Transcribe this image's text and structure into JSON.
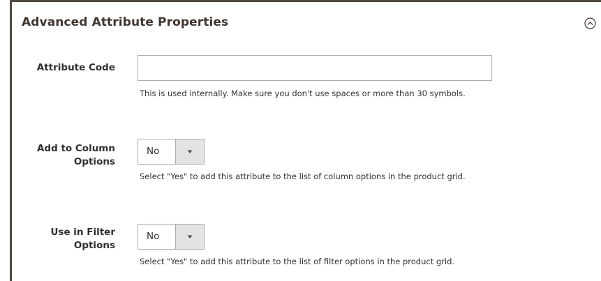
{
  "section": {
    "title": "Advanced Attribute Properties",
    "toggle_icon": "chevron-up-circle-icon"
  },
  "fields": {
    "attribute_code": {
      "label": "Attribute Code",
      "value": "",
      "note": "This is used internally. Make sure you don't use spaces or more than 30 symbols."
    },
    "add_to_column_options": {
      "label_line1": "Add to Column",
      "label_line2": "Options",
      "value": "No",
      "note": "Select \"Yes\" to add this attribute to the list of column options in the product grid."
    },
    "use_in_filter_options": {
      "label_line1": "Use in Filter",
      "label_line2": "Options",
      "value": "No",
      "note": "Select \"Yes\" to add this attribute to the list of filter options in the product grid."
    }
  },
  "colors": {
    "frame_border": "#514943",
    "input_border": "#adadad",
    "select_arrow_bg": "#e3e3e3",
    "text": "#303030"
  }
}
